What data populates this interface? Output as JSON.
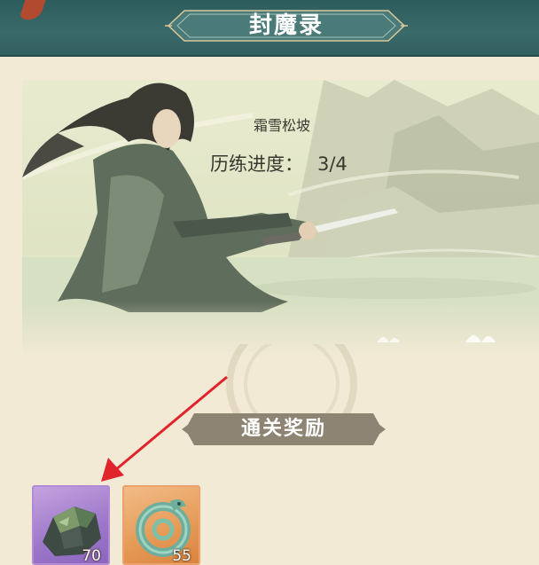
{
  "header": {
    "title": "封魔录"
  },
  "stage": {
    "area_name": "霜雪松坡",
    "progress_label": "历练进度：",
    "progress_value": "3/4"
  },
  "rewards": {
    "label": "通关奖励",
    "items": [
      {
        "icon": "ore-stone-icon",
        "count": "70",
        "rarity_color": "#a57fd0"
      },
      {
        "icon": "jade-dragon-icon",
        "count": "55",
        "rarity_color": "#e59a56"
      }
    ]
  },
  "colors": {
    "header_bg": "#3a6a69",
    "page_bg": "#f3ead6",
    "arrow": "#e0242b"
  }
}
